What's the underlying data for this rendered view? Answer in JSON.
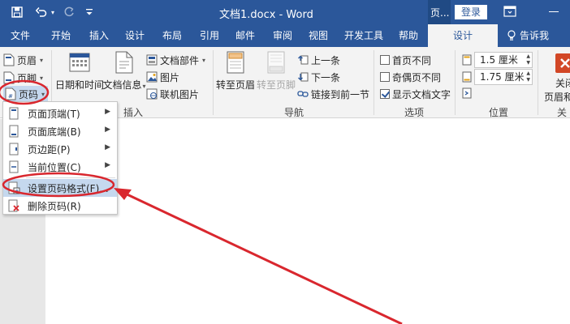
{
  "title_bar": {
    "title": "文档1.docx - Word",
    "context_tools_label": "页...",
    "login_label": "登录"
  },
  "tabs": [
    {
      "label": "文件"
    },
    {
      "label": "开始"
    },
    {
      "label": "插入"
    },
    {
      "label": "设计"
    },
    {
      "label": "布局"
    },
    {
      "label": "引用"
    },
    {
      "label": "邮件"
    },
    {
      "label": "审阅"
    },
    {
      "label": "视图"
    },
    {
      "label": "开发工具"
    },
    {
      "label": "帮助"
    },
    {
      "label": "设计"
    }
  ],
  "tell_me": "告诉我",
  "ribbon": {
    "header_footer": {
      "header": "页眉",
      "footer": "页脚",
      "page_number": "页码"
    },
    "insert": {
      "date_time": "日期和时间",
      "doc_info": "文档信息",
      "doc_parts": "文档部件",
      "picture": "图片",
      "online_picture": "联机图片",
      "group_label": "插入"
    },
    "navigation": {
      "goto_header": "转至页眉",
      "goto_footer": "转至页脚",
      "previous": "上一条",
      "next": "下一条",
      "link_previous": "链接到前一节",
      "group_label": "导航"
    },
    "options": {
      "diff_first": "首页不同",
      "diff_odd_even": "奇偶页不同",
      "show_doc_text": "显示文档文字",
      "group_label": "选项"
    },
    "position": {
      "header_top": "1.5 厘米",
      "footer_bottom": "1.75 厘米",
      "group_label": "位置"
    },
    "close": {
      "label_line1": "关闭",
      "label_line2": "页眉和",
      "group_label": "关闭"
    }
  },
  "dropdown": {
    "items": [
      {
        "label": "页面顶端(T)"
      },
      {
        "label": "页面底端(B)"
      },
      {
        "label": "页边距(P)"
      },
      {
        "label": "当前位置(C)"
      },
      {
        "label": "设置页码格式(F)..."
      },
      {
        "label": "删除页码(R)"
      }
    ]
  },
  "colors": {
    "word_blue": "#2b579a",
    "annotation_red": "#d9272e",
    "highlight": "#c5d8ee"
  }
}
